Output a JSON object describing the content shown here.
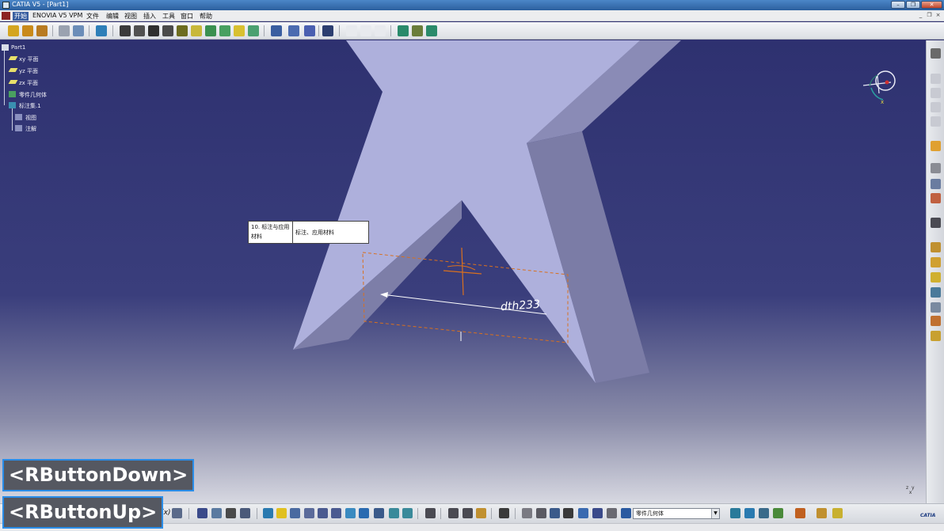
{
  "window": {
    "title": "CATIA V5 - [Part1]",
    "controls": {
      "minimize": "–",
      "maximize": "❐",
      "close": "✕"
    },
    "mdi_controls": {
      "minimize": "_",
      "restore": "❐",
      "close": "×"
    }
  },
  "menu": {
    "items": [
      "开始",
      "ENOVIA V5 VPM",
      "文件",
      "编辑",
      "视图",
      "插入",
      "工具",
      "窗口",
      "帮助"
    ]
  },
  "tree": {
    "root": "Part1",
    "items": [
      "xy 平面",
      "yz 平面",
      "zx 平面",
      "零件几何体",
      "标注集.1",
      "视图",
      "注解"
    ]
  },
  "tooltip": {
    "left": "10. 标注与应用材料",
    "right": "标注、应用材料"
  },
  "annotation": {
    "handwriting": "dth233"
  },
  "compass": {
    "axis_label": "x"
  },
  "mini_axis": {
    "label": "z  y\n  x"
  },
  "bottom": {
    "formula_label": "f(x)",
    "combo_value": "零件几何体",
    "combo_arrow": "▼",
    "brand": "CATIA"
  },
  "overlays": {
    "button_down": "<RButtonDown>",
    "button_up": "<RButtonUp>"
  },
  "colors": {
    "viewport_top": "#2e3170",
    "part_face": "#aeb0dc",
    "part_side": "#7b7ca6",
    "annotation_orange": "#d9701e",
    "overlay_border": "#2a8de8"
  }
}
